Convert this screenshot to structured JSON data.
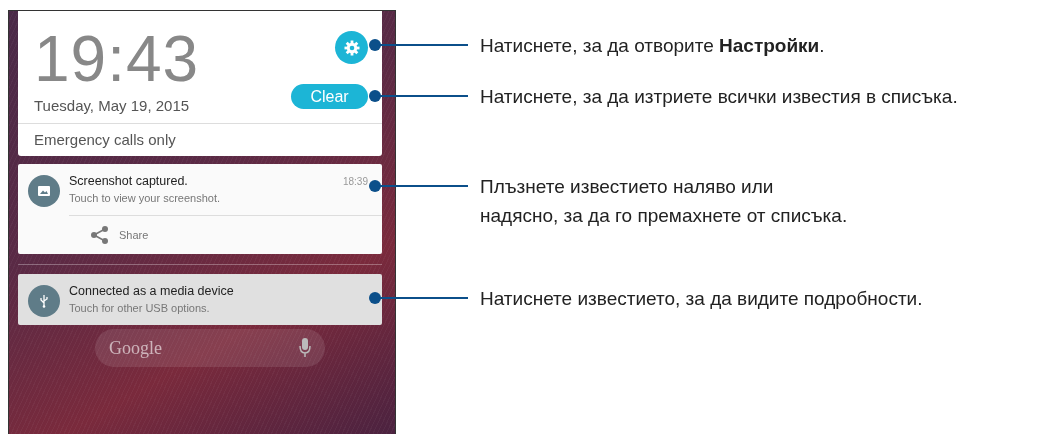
{
  "phone": {
    "clock": {
      "time": "19:43",
      "date": "Tuesday, May 19, 2015",
      "clear_button": "Clear",
      "status": "Emergency calls only"
    },
    "notifications": [
      {
        "kind": "screenshot",
        "title": "Screenshot captured.",
        "text": "Touch to view your screenshot.",
        "time": "18:39",
        "action": "Share"
      },
      {
        "kind": "usb",
        "title": "Connected as a media device",
        "text": "Touch for other USB options."
      }
    ],
    "search": {
      "placeholder": "Google"
    }
  },
  "callouts": [
    {
      "lines": [
        "Натиснете, за да отворите **Настройки**."
      ]
    },
    {
      "lines": [
        "Натиснете, за да изтриете всички известия в списъка."
      ]
    },
    {
      "lines": [
        "Плъзнете известието наляво или",
        "надясно, за да го премахнете от списъка."
      ]
    },
    {
      "lines": [
        "Натиснете известието, за да видите подробности."
      ]
    }
  ]
}
